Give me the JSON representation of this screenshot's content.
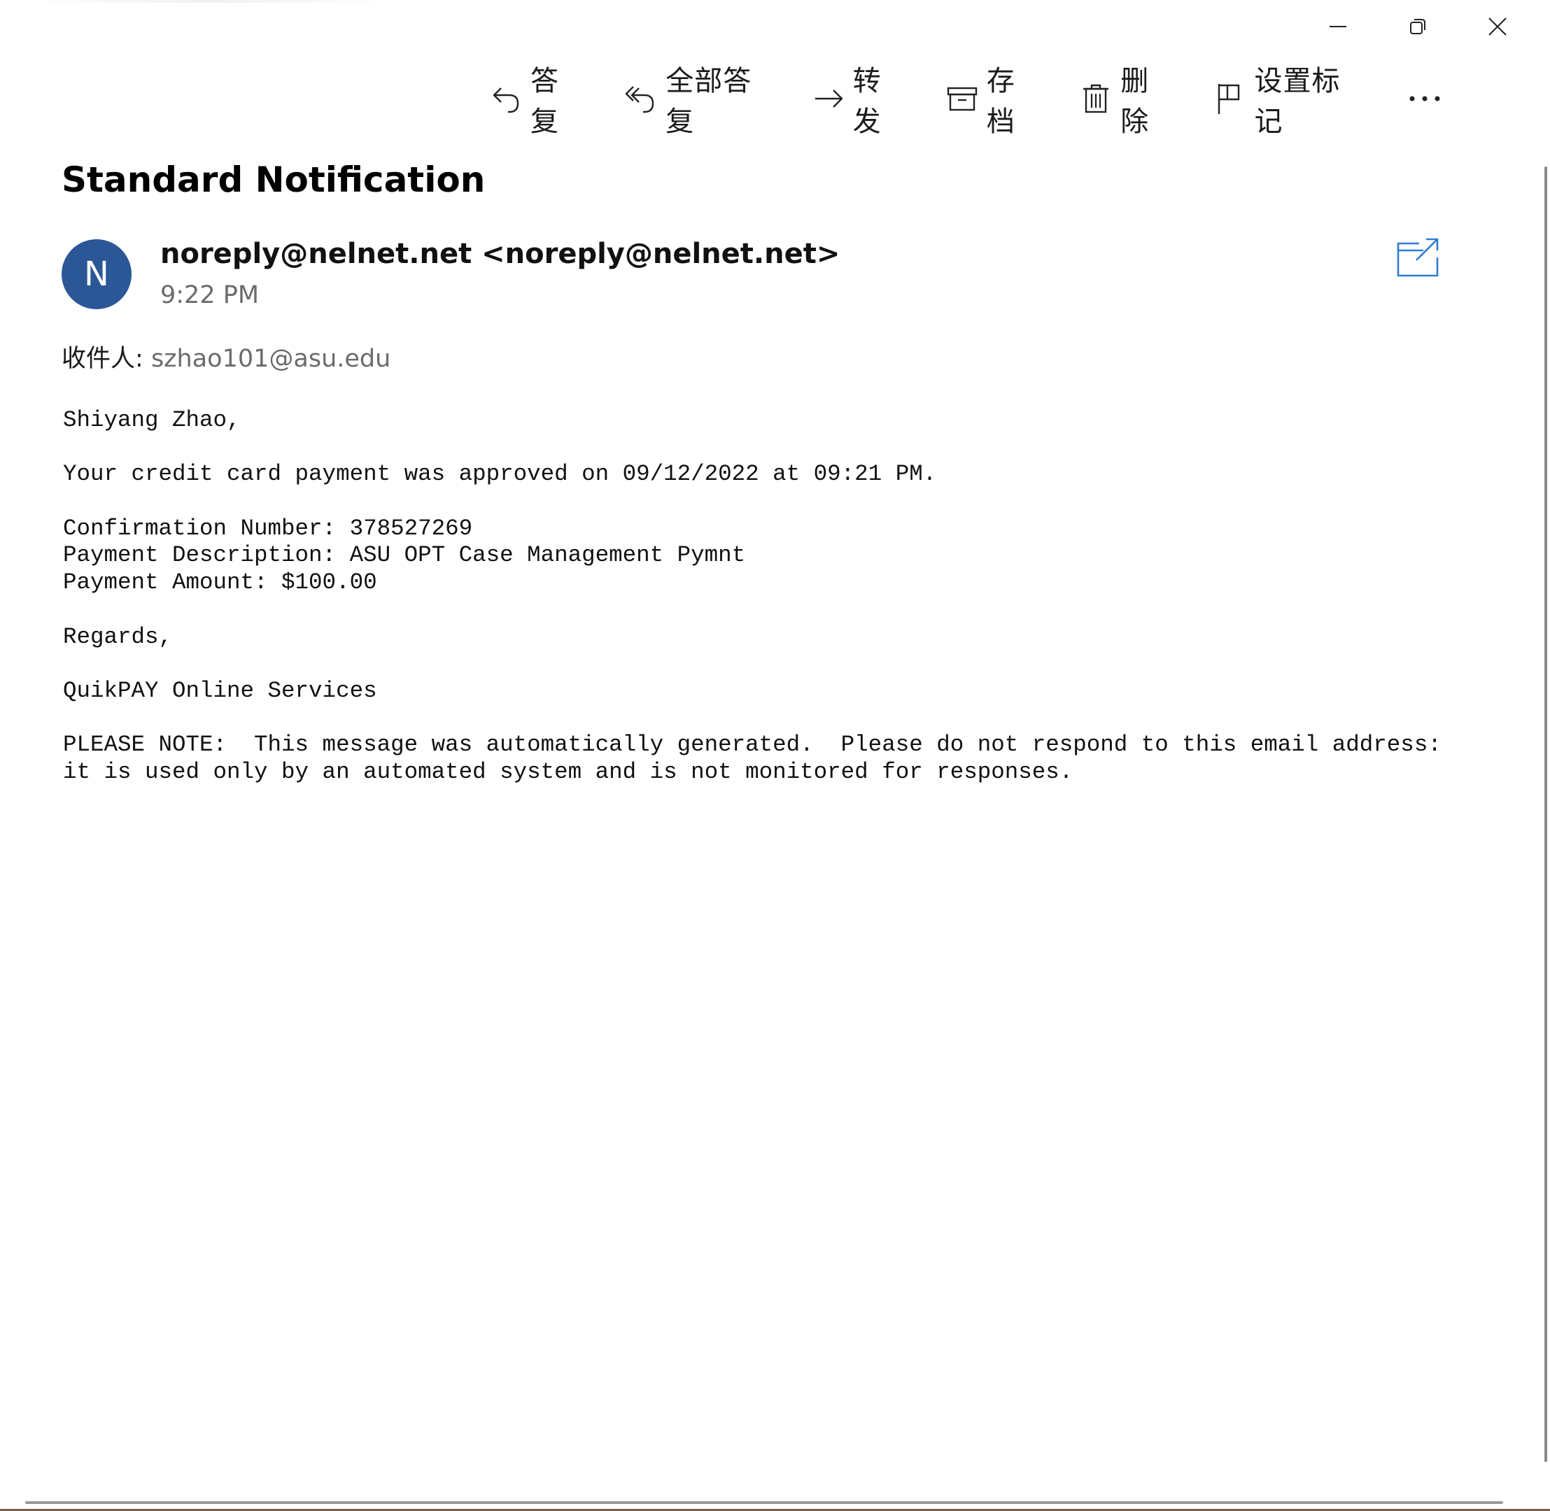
{
  "toolbar": {
    "reply": {
      "label": "答复",
      "icon": "reply-icon"
    },
    "reply_all": {
      "label": "全部答复",
      "icon": "reply-all-icon"
    },
    "forward": {
      "label": "转发",
      "icon": "forward-icon"
    },
    "archive": {
      "label": "存档",
      "icon": "archive-icon"
    },
    "delete": {
      "label": "删除",
      "icon": "trash-icon"
    },
    "flag": {
      "label": "设置标记",
      "icon": "flag-icon"
    },
    "more": {
      "icon": "more-icon"
    }
  },
  "window_controls": {
    "minimize": "minimize-icon",
    "restore": "restore-icon",
    "close": "close-icon"
  },
  "message": {
    "subject": "Standard Notification",
    "avatar_initial": "N",
    "avatar_color": "#2b5797",
    "sender": "noreply@nelnet.net <noreply@nelnet.net>",
    "time": "9:22 PM",
    "to_label": "收件人:",
    "to_address": "szhao101@asu.edu",
    "body": {
      "greeting": "Shiyang Zhao,",
      "line_approved": "Your credit card payment was approved on 09/12/2022 at 09:21 PM.",
      "confirmation": "Confirmation Number: 378527269",
      "description": "Payment Description: ASU OPT Case Management Pymnt",
      "amount": "Payment Amount: $100.00",
      "regards": "Regards,",
      "signature": "QuikPAY Online Services",
      "note_line1": "PLEASE NOTE:  This message was automatically generated.  Please do not respond to this email address:",
      "note_line2": "it is used only by an automated system and is not monitored for responses."
    }
  },
  "colors": {
    "accent": "#2b5797",
    "popout_icon": "#2f7bd4",
    "secondary_text": "#6b6b6b"
  }
}
